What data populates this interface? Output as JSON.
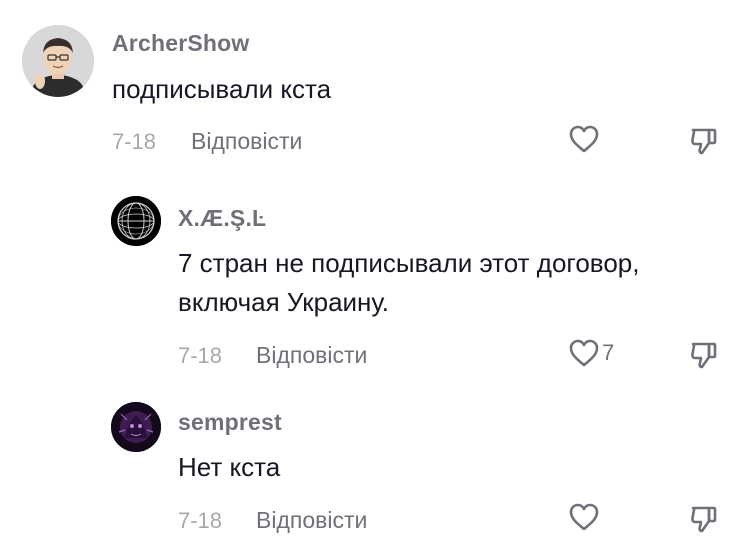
{
  "comments": [
    {
      "username": "ArcherShow",
      "text": "подписывали кста",
      "date": "7-18",
      "reply_label": "Відповісти",
      "like_icon": "heart-outline-icon",
      "dislike_icon": "thumbs-down-icon"
    },
    {
      "username": "X.Æ.Ş.Ŀ",
      "text_lines": [
        "7 стран не подписывали этот договор,",
        "включая Украину."
      ],
      "date": "7-18",
      "reply_label": "Відповісти",
      "like_count": "7",
      "like_icon": "heart-outline-icon",
      "dislike_icon": "thumbs-down-icon"
    },
    {
      "username": "semprest",
      "text": "Нет кста",
      "date": "7-18",
      "reply_label": "Відповісти",
      "like_icon": "heart-outline-icon",
      "dislike_icon": "thumbs-down-icon"
    }
  ],
  "colors": {
    "text_primary": "#161823",
    "text_secondary": "#6f7179",
    "text_muted": "#a7a9ae",
    "background": "#ffffff"
  }
}
